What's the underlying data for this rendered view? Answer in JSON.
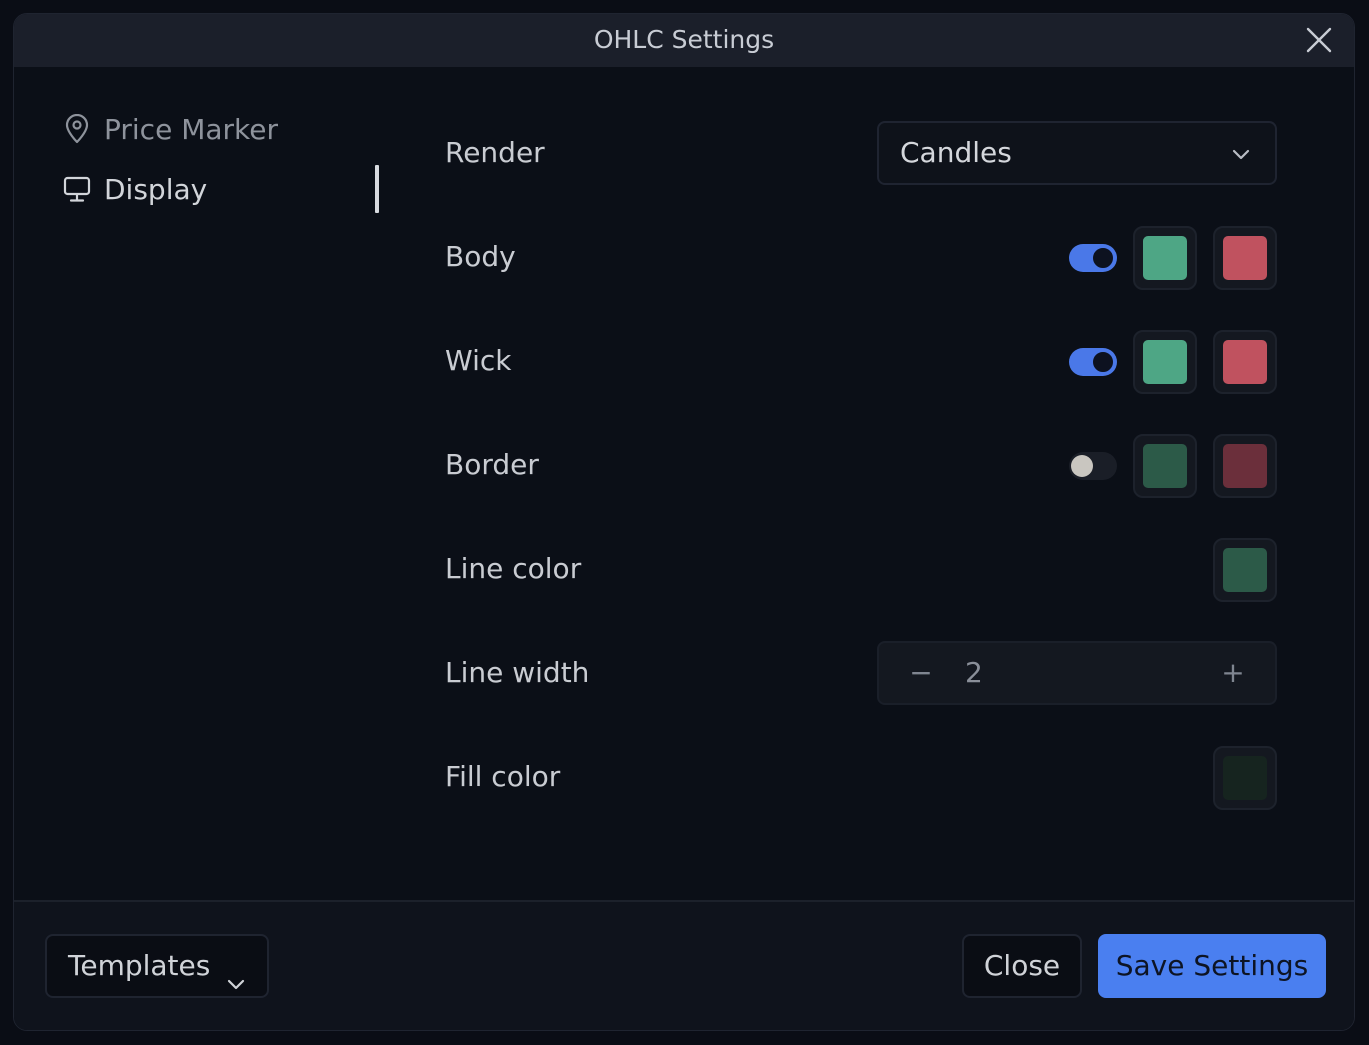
{
  "dialog": {
    "title": "OHLC Settings"
  },
  "sidebar": {
    "items": [
      {
        "label": "Price Marker",
        "icon": "map-pin-icon",
        "active": false
      },
      {
        "label": "Display",
        "icon": "monitor-icon",
        "active": true
      }
    ]
  },
  "settings": {
    "render": {
      "label": "Render",
      "value": "Candles"
    },
    "body": {
      "label": "Body",
      "enabled": true,
      "up_color": "#4ea685",
      "down_color": "#c0525f"
    },
    "wick": {
      "label": "Wick",
      "enabled": true,
      "up_color": "#4ea685",
      "down_color": "#c0525f"
    },
    "border": {
      "label": "Border",
      "enabled": false,
      "up_color": "#2c5a48",
      "down_color": "#6b2f3b"
    },
    "line_color": {
      "label": "Line color",
      "color": "#2c5a48"
    },
    "line_width": {
      "label": "Line width",
      "value": "2",
      "minus": "−",
      "plus": "+"
    },
    "fill_color": {
      "label": "Fill color",
      "color": "#16241f"
    }
  },
  "footer": {
    "templates_label": "Templates",
    "close_label": "Close",
    "save_label": "Save Settings"
  },
  "colors": {
    "accent": "#4a7ff0",
    "toggle_on": "#4a78e8"
  }
}
